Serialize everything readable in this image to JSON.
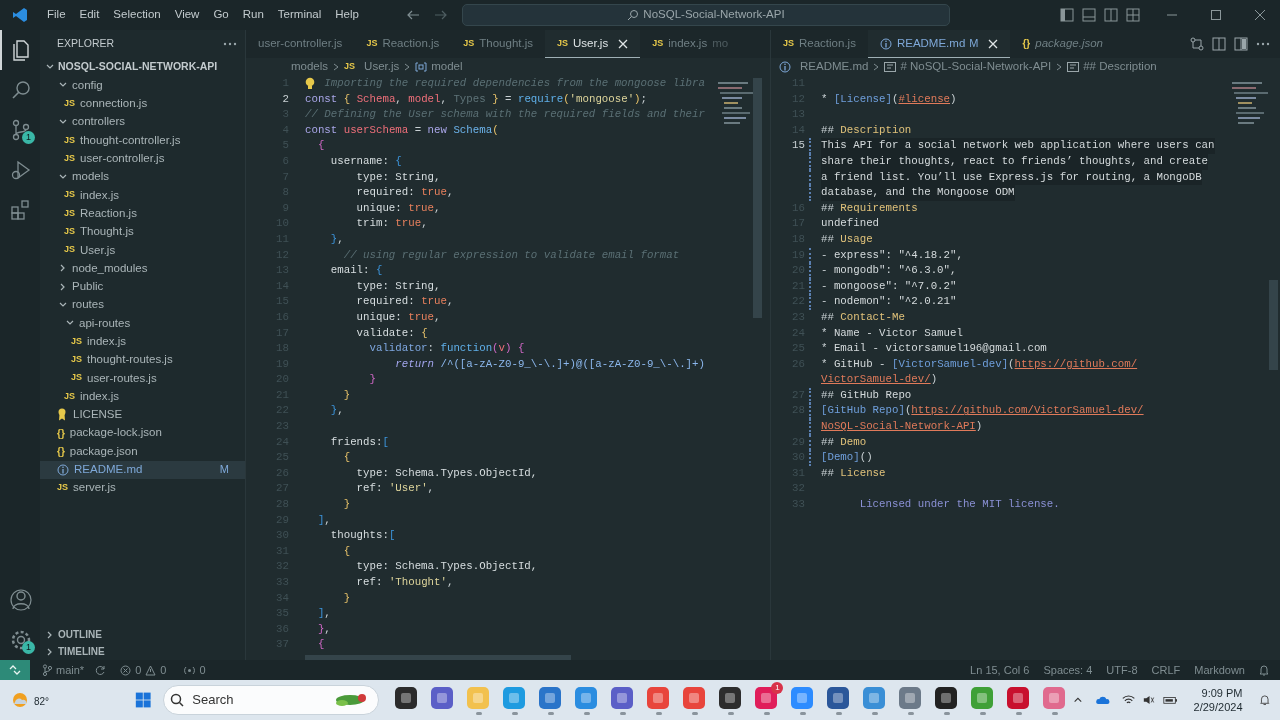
{
  "title_bar": {
    "menu": [
      "File",
      "Edit",
      "Selection",
      "View",
      "Go",
      "Run",
      "Terminal",
      "Help"
    ],
    "search": "NoSQL-Social-Network-API"
  },
  "activity_bar": {
    "top": [
      {
        "kind": "explorer",
        "selected": true
      },
      {
        "kind": "search",
        "selected": false
      },
      {
        "kind": "scm",
        "selected": false,
        "badge": "1"
      },
      {
        "kind": "debug",
        "selected": false
      },
      {
        "kind": "extensions",
        "selected": false
      }
    ],
    "bottom": [
      {
        "kind": "account"
      },
      {
        "kind": "settings",
        "badge": "1"
      }
    ]
  },
  "explorer": {
    "title": "EXPLORER",
    "root": {
      "label": "NOSQL-SOCIAL-NETWORK-API",
      "expanded": true,
      "children": [
        {
          "kind": "folder",
          "label": "config",
          "expanded": true,
          "selected": false,
          "children": [
            {
              "kind": "js",
              "glyph": "JS",
              "label": "connection.js",
              "selected": false
            }
          ]
        },
        {
          "kind": "folder",
          "label": "controllers",
          "expanded": true,
          "selected": false,
          "children": [
            {
              "kind": "js",
              "glyph": "JS",
              "label": "thought-controller.js",
              "selected": false
            },
            {
              "kind": "js",
              "glyph": "JS",
              "label": "user-controller.js",
              "selected": false
            }
          ]
        },
        {
          "kind": "folder",
          "label": "models",
          "expanded": true,
          "selected": false,
          "children": [
            {
              "kind": "js",
              "glyph": "JS",
              "label": "index.js",
              "selected": false
            },
            {
              "kind": "js",
              "glyph": "JS",
              "label": "Reaction.js",
              "selected": false
            },
            {
              "kind": "js",
              "glyph": "JS",
              "label": "Thought.js",
              "selected": false
            },
            {
              "kind": "js",
              "glyph": "JS",
              "label": "User.js",
              "selected": false
            }
          ]
        },
        {
          "kind": "folder",
          "label": "node_modules",
          "expanded": false,
          "selected": false
        },
        {
          "kind": "folder",
          "label": "Public",
          "expanded": false,
          "selected": false
        },
        {
          "kind": "folder",
          "label": "routes",
          "expanded": true,
          "selected": false,
          "children": [
            {
              "kind": "folder",
              "label": "api-routes",
              "expanded": true,
              "selected": false,
              "children": [
                {
                  "kind": "js",
                  "glyph": "JS",
                  "label": "index.js",
                  "selected": false
                },
                {
                  "kind": "js",
                  "glyph": "JS",
                  "label": "thought-routes.js",
                  "selected": false
                },
                {
                  "kind": "js",
                  "glyph": "JS",
                  "label": "user-routes.js",
                  "selected": false
                }
              ]
            },
            {
              "kind": "js",
              "glyph": "JS",
              "label": "index.js",
              "selected": false
            }
          ]
        },
        {
          "kind": "license",
          "label": "LICENSE",
          "selected": false
        },
        {
          "kind": "json",
          "glyph": "{}",
          "label": "package-lock.json",
          "selected": false
        },
        {
          "kind": "json",
          "glyph": "{}",
          "label": "package.json",
          "selected": false
        },
        {
          "kind": "md",
          "label": "README.md",
          "selected": true,
          "badge": "M"
        },
        {
          "kind": "js",
          "glyph": "JS",
          "label": "server.js",
          "selected": false
        }
      ]
    },
    "sections": [
      {
        "label": "OUTLINE",
        "expanded": false
      },
      {
        "label": "TIMELINE",
        "expanded": false
      }
    ]
  },
  "editors": [
    {
      "tabs": [
        {
          "label": "user-controller.js",
          "selected": false
        },
        {
          "kind": "js",
          "glyph": "JS",
          "label": "Reaction.js",
          "selected": false
        },
        {
          "kind": "js",
          "glyph": "JS",
          "label": "Thought.js",
          "selected": false
        },
        {
          "kind": "js",
          "glyph": "JS",
          "label": "User.js",
          "selected": true
        },
        {
          "kind": "js",
          "glyph": "JS",
          "label": "index.js",
          "description": "mo",
          "selected": false
        }
      ],
      "breadcrumbs": [
        {
          "kind": "folder",
          "label": "models"
        },
        {
          "kind": "js",
          "glyph": "JS",
          "label": "User.js"
        },
        {
          "kind": "symbol",
          "label": "model"
        }
      ],
      "lines": [
        {
          "number": "1",
          "lightbulb": true,
          "tokens": [
            {
              "text": "Importing the required dependencies from the mongoose libra",
              "kind": "cm"
            }
          ]
        },
        {
          "number": "2",
          "current": true,
          "tokens": [
            {
              "text": "const ",
              "kind": "kw"
            },
            {
              "text": "{ ",
              "kind": "b1"
            },
            {
              "text": "Schema",
              "kind": "var"
            },
            {
              "text": ", ",
              "kind": "punct"
            },
            {
              "text": "model",
              "kind": "var"
            },
            {
              "text": ", ",
              "kind": "punct"
            },
            {
              "text": "Types",
              "kind": "dim"
            },
            {
              "text": " } ",
              "kind": "b1"
            },
            {
              "text": "= ",
              "kind": "punct"
            },
            {
              "text": "require",
              "kind": "fn"
            },
            {
              "text": "(",
              "kind": "b1"
            },
            {
              "text": "'mongoose'",
              "kind": "str"
            },
            {
              "text": ")",
              "kind": "b1"
            },
            {
              "text": ";",
              "kind": "punct"
            }
          ]
        },
        {
          "number": "3",
          "tokens": [
            {
              "text": "// Defining the User schema with the required fields and their",
              "kind": "cm"
            }
          ]
        },
        {
          "number": "4",
          "tokens": [
            {
              "text": "const ",
              "kind": "kw"
            },
            {
              "text": "userSchema",
              "kind": "var"
            },
            {
              "text": " = ",
              "kind": "punct"
            },
            {
              "text": "new ",
              "kind": "kw"
            },
            {
              "text": "Schema",
              "kind": "cls"
            },
            {
              "text": "(",
              "kind": "b1"
            }
          ]
        },
        {
          "number": "5",
          "tokens": [
            {
              "text": "  {",
              "kind": "b2"
            }
          ]
        },
        {
          "number": "6",
          "tokens": [
            {
              "text": "    username: ",
              "kind": "prop"
            },
            {
              "text": "{",
              "kind": "b3"
            }
          ]
        },
        {
          "number": "7",
          "tokens": [
            {
              "text": "        type: String,",
              "kind": "prop"
            }
          ]
        },
        {
          "number": "8",
          "tokens": [
            {
              "text": "        required: ",
              "kind": "prop"
            },
            {
              "text": "true",
              "kind": "bool"
            },
            {
              "text": ",",
              "kind": "punct"
            }
          ]
        },
        {
          "number": "9",
          "tokens": [
            {
              "text": "        unique: ",
              "kind": "prop"
            },
            {
              "text": "true",
              "kind": "bool"
            },
            {
              "text": ",",
              "kind": "punct"
            }
          ]
        },
        {
          "number": "10",
          "tokens": [
            {
              "text": "        trim: ",
              "kind": "prop"
            },
            {
              "text": "true",
              "kind": "bool"
            },
            {
              "text": ",",
              "kind": "punct"
            }
          ]
        },
        {
          "number": "11",
          "tokens": [
            {
              "text": "    }",
              "kind": "b3"
            },
            {
              "text": ",",
              "kind": "punct"
            }
          ]
        },
        {
          "number": "12",
          "tokens": [
            {
              "text": "      // using regular expression to validate email format",
              "kind": "cm"
            }
          ]
        },
        {
          "number": "13",
          "tokens": [
            {
              "text": "    email: ",
              "kind": "prop"
            },
            {
              "text": "{",
              "kind": "b3"
            }
          ]
        },
        {
          "number": "14",
          "tokens": [
            {
              "text": "        type: String,",
              "kind": "prop"
            }
          ]
        },
        {
          "number": "15",
          "tokens": [
            {
              "text": "        required: ",
              "kind": "prop"
            },
            {
              "text": "true",
              "kind": "bool"
            },
            {
              "text": ",",
              "kind": "punct"
            }
          ]
        },
        {
          "number": "16",
          "tokens": [
            {
              "text": "        unique: ",
              "kind": "prop"
            },
            {
              "text": "true",
              "kind": "bool"
            },
            {
              "text": ",",
              "kind": "punct"
            }
          ]
        },
        {
          "number": "17",
          "tokens": [
            {
              "text": "        validate: ",
              "kind": "prop"
            },
            {
              "text": "{",
              "kind": "b1"
            }
          ]
        },
        {
          "number": "18",
          "tokens": [
            {
              "text": "          validator",
              "kind": "key2"
            },
            {
              "text": ": ",
              "kind": "punct"
            },
            {
              "text": "function",
              "kind": "fn"
            },
            {
              "text": "(",
              "kind": "b2"
            },
            {
              "text": "v",
              "kind": "var"
            },
            {
              "text": ") ",
              "kind": "b2"
            },
            {
              "text": "{",
              "kind": "b2"
            }
          ]
        },
        {
          "number": "19",
          "tokens": [
            {
              "text": "              return ",
              "kind": "ret"
            },
            {
              "text": "/^([a-zA-Z0-9_\\-\\.]+)@([a-zA-Z0-9_\\-\\.]+)",
              "kind": "rx"
            }
          ]
        },
        {
          "number": "20",
          "tokens": [
            {
              "text": "          }",
              "kind": "b2"
            }
          ]
        },
        {
          "number": "21",
          "tokens": [
            {
              "text": "      }",
              "kind": "b1"
            }
          ]
        },
        {
          "number": "22",
          "tokens": [
            {
              "text": "    }",
              "kind": "b3"
            },
            {
              "text": ",",
              "kind": "punct"
            }
          ]
        },
        {
          "number": "23"
        },
        {
          "number": "24",
          "tokens": [
            {
              "text": "    friends:",
              "kind": "prop"
            },
            {
              "text": "[",
              "kind": "b3"
            }
          ]
        },
        {
          "number": "25",
          "tokens": [
            {
              "text": "      {",
              "kind": "b1"
            }
          ]
        },
        {
          "number": "26",
          "tokens": [
            {
              "text": "        type: Schema.Types.ObjectId,",
              "kind": "prop"
            }
          ]
        },
        {
          "number": "27",
          "tokens": [
            {
              "text": "        ref: ",
              "kind": "prop"
            },
            {
              "text": "'User'",
              "kind": "str"
            },
            {
              "text": ",",
              "kind": "punct"
            }
          ]
        },
        {
          "number": "28",
          "tokens": [
            {
              "text": "      }",
              "kind": "b1"
            }
          ]
        },
        {
          "number": "29",
          "tokens": [
            {
              "text": "  ]",
              "kind": "b3"
            },
            {
              "text": ",",
              "kind": "punct"
            }
          ]
        },
        {
          "number": "30",
          "tokens": [
            {
              "text": "    thoughts:",
              "kind": "prop"
            },
            {
              "text": "[",
              "kind": "b3"
            }
          ]
        },
        {
          "number": "31",
          "tokens": [
            {
              "text": "      {",
              "kind": "b1"
            }
          ]
        },
        {
          "number": "32",
          "tokens": [
            {
              "text": "        type: Schema.Types.ObjectId,",
              "kind": "prop"
            }
          ]
        },
        {
          "number": "33",
          "tokens": [
            {
              "text": "        ref: ",
              "kind": "prop"
            },
            {
              "text": "'Thought'",
              "kind": "str"
            },
            {
              "text": ",",
              "kind": "punct"
            }
          ]
        },
        {
          "number": "34",
          "tokens": [
            {
              "text": "      }",
              "kind": "b1"
            }
          ]
        },
        {
          "number": "35",
          "tokens": [
            {
              "text": "  ]",
              "kind": "b3"
            },
            {
              "text": ",",
              "kind": "punct"
            }
          ]
        },
        {
          "number": "36",
          "tokens": [
            {
              "text": "  }",
              "kind": "b2"
            },
            {
              "text": ",",
              "kind": "punct"
            }
          ]
        },
        {
          "number": "37",
          "tokens": [
            {
              "text": "  {",
              "kind": "b2"
            }
          ]
        }
      ]
    },
    {
      "tabs": [
        {
          "kind": "js",
          "glyph": "JS",
          "label": "Reaction.js",
          "selected": false
        },
        {
          "kind": "md",
          "label": "README.md",
          "badge": "M",
          "selected": true
        },
        {
          "kind": "json",
          "glyph": "{}",
          "label": "package.json",
          "preview": true,
          "selected": false
        }
      ],
      "breadcrumbs": [
        {
          "kind": "md",
          "label": "README.md"
        },
        {
          "kind": "heading",
          "label": "# NoSQL-Social-Network-API"
        },
        {
          "kind": "heading",
          "label": "## Description"
        }
      ],
      "lines": [
        {
          "number": "11"
        },
        {
          "number": "12",
          "tokens": [
            {
              "text": "* ",
              "kind": "punct"
            },
            {
              "text": "[License]",
              "kind": "link"
            },
            {
              "text": "(",
              "kind": "punct"
            },
            {
              "text": "#license",
              "kind": "url"
            },
            {
              "text": ")",
              "kind": "punct"
            }
          ]
        },
        {
          "number": "13"
        },
        {
          "number": "14",
          "tokens": [
            {
              "text": "## ",
              "kind": "hash"
            },
            {
              "text": "Description",
              "kind": "head"
            }
          ]
        },
        {
          "number": "15",
          "current": true,
          "changed": true,
          "tokens": [
            {
              "text": "This API for a social network web application where users can",
              "kind": "text"
            }
          ]
        },
        {
          "current": true,
          "changed": true,
          "tokens": [
            {
              "text": "share their thoughts, react to friends’ thoughts, and create",
              "kind": "text"
            }
          ]
        },
        {
          "current": true,
          "changed": true,
          "tokens": [
            {
              "text": "a friend list. You’ll use Express.js for routing, a MongoDB",
              "kind": "text"
            }
          ]
        },
        {
          "current": true,
          "changed": true,
          "tokens": [
            {
              "text": "database, and the Mongoose ODM",
              "kind": "text"
            }
          ]
        },
        {
          "number": "16",
          "tokens": [
            {
              "text": "## ",
              "kind": "hash"
            },
            {
              "text": "Requirements",
              "kind": "head"
            }
          ]
        },
        {
          "number": "17",
          "tokens": [
            {
              "text": "undefined",
              "kind": "text"
            }
          ]
        },
        {
          "number": "18",
          "tokens": [
            {
              "text": "## ",
              "kind": "hash"
            },
            {
              "text": "Usage",
              "kind": "head"
            }
          ]
        },
        {
          "number": "19",
          "changed": true,
          "tokens": [
            {
              "text": "- ",
              "kind": "punct"
            },
            {
              "text": "express\": \"^4.18.2\",",
              "kind": "text"
            }
          ]
        },
        {
          "number": "20",
          "changed": true,
          "tokens": [
            {
              "text": "- ",
              "kind": "punct"
            },
            {
              "text": "mongodb\": \"^6.3.0\",",
              "kind": "text"
            }
          ]
        },
        {
          "number": "21",
          "changed": true,
          "tokens": [
            {
              "text": "- ",
              "kind": "punct"
            },
            {
              "text": "mongoose\": \"^7.0.2\"",
              "kind": "text"
            }
          ]
        },
        {
          "number": "22",
          "changed": true,
          "tokens": [
            {
              "text": "- ",
              "kind": "punct"
            },
            {
              "text": "nodemon\": \"^2.0.21\"",
              "kind": "text"
            }
          ]
        },
        {
          "number": "23",
          "tokens": [
            {
              "text": "## ",
              "kind": "hash"
            },
            {
              "text": "Contact-Me",
              "kind": "head"
            }
          ]
        },
        {
          "number": "24",
          "tokens": [
            {
              "text": "* ",
              "kind": "punct"
            },
            {
              "text": "Name - Victor Samuel",
              "kind": "text"
            }
          ]
        },
        {
          "number": "25",
          "tokens": [
            {
              "text": "* ",
              "kind": "punct"
            },
            {
              "text": "Email - victorsamuel196@gmail.com",
              "kind": "text"
            }
          ]
        },
        {
          "number": "26",
          "tokens": [
            {
              "text": "* ",
              "kind": "punct"
            },
            {
              "text": "GitHub - ",
              "kind": "text"
            },
            {
              "text": "[VictorSamuel-dev]",
              "kind": "link"
            },
            {
              "text": "(",
              "kind": "punct"
            },
            {
              "text": "https://github.com/",
              "kind": "url"
            }
          ]
        },
        {
          "tokens": [
            {
              "text": "VictorSamuel-dev/",
              "kind": "url"
            },
            {
              "text": ")",
              "kind": "punct"
            }
          ]
        },
        {
          "number": "27",
          "changed": true,
          "tokens": [
            {
              "text": "## ",
              "kind": "hash"
            },
            {
              "text": "GitHub Repo",
              "kind": "text"
            }
          ]
        },
        {
          "number": "28",
          "changed": true,
          "tokens": [
            {
              "text": "[GitHub Repo]",
              "kind": "link"
            },
            {
              "text": "(",
              "kind": "punct"
            },
            {
              "text": "https://github.com/VictorSamuel-dev/",
              "kind": "url"
            }
          ]
        },
        {
          "changed": true,
          "tokens": [
            {
              "text": "NoSQL-Social-Network-API",
              "kind": "url"
            },
            {
              "text": ")",
              "kind": "punct"
            }
          ]
        },
        {
          "number": "29",
          "changed": true,
          "tokens": [
            {
              "text": "## ",
              "kind": "hash"
            },
            {
              "text": "Demo",
              "kind": "head"
            }
          ]
        },
        {
          "number": "30",
          "changed": true,
          "tokens": [
            {
              "text": "[Demo]",
              "kind": "link"
            },
            {
              "text": "()",
              "kind": "punct"
            }
          ]
        },
        {
          "number": "31",
          "tokens": [
            {
              "text": "## ",
              "kind": "hash"
            },
            {
              "text": "License",
              "kind": "head"
            }
          ]
        },
        {
          "number": "32"
        },
        {
          "number": "33",
          "tokens": [
            {
              "text": "      Licensed under the MIT license.",
              "kind": "lic"
            }
          ]
        }
      ]
    }
  ],
  "status_bar": {
    "branch": "main*",
    "errors": "0",
    "warnings": "0",
    "ports": "0",
    "right": [
      "Ln 15, Col 6",
      "Spaces: 4",
      "UTF-8",
      "CRLF",
      "Markdown"
    ]
  },
  "taskbar": {
    "weather": "82°",
    "search": "Search",
    "apps": [
      {
        "color": "#2b2b2b"
      },
      {
        "color": "#5b5fc7"
      },
      {
        "color": "#f2c14e",
        "running": true
      },
      {
        "color": "#1e9be0",
        "running": true
      },
      {
        "color": "#2a74c9",
        "running": true
      },
      {
        "color": "#2b8de0",
        "running": true
      },
      {
        "color": "#5b5fc7",
        "running": true
      },
      {
        "color": "#e8453c",
        "running": true
      },
      {
        "color": "#e8453c",
        "running": true
      },
      {
        "color": "#2d2d2d",
        "running": true
      },
      {
        "color": "#e01e5a",
        "running": true,
        "badge": "1"
      },
      {
        "color": "#2d8cff",
        "running": true
      },
      {
        "color": "#2b579a",
        "running": true
      },
      {
        "color": "#3a8fd6",
        "running": true
      },
      {
        "color": "#6c7a89",
        "running": true
      },
      {
        "color": "#222222",
        "running": true
      },
      {
        "color": "#3fa037",
        "running": true
      },
      {
        "color": "#c8102e",
        "running": true
      },
      {
        "color": "#e06a8e",
        "running": true
      }
    ],
    "time": "9:09 PM",
    "date": "2/29/2024"
  }
}
